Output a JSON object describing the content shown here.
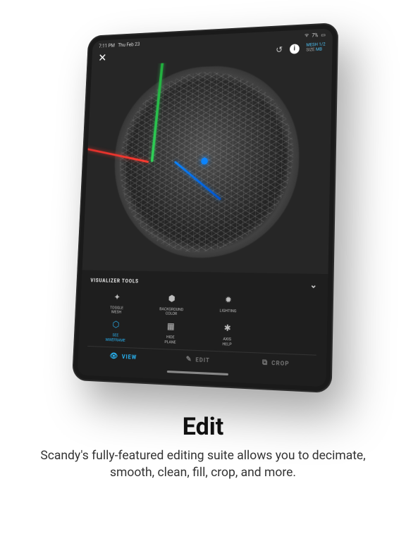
{
  "statusbar": {
    "time": "7:11 PM",
    "date": "Thu Feb 23",
    "wifi": "wifi-icon",
    "battery_pct": "7%"
  },
  "topbar": {
    "close": "✕",
    "undo": "↺",
    "info": "i",
    "mesh_label": "MESH",
    "mesh_count": "1/2",
    "size_label": "SIZE",
    "size_value": "MB"
  },
  "tools": {
    "header": "VISUALIZER TOOLS",
    "items": [
      {
        "icon": "✦",
        "label": "TOGGLE\nMESH"
      },
      {
        "icon": "⬡",
        "label": "SEE\nWIREFRAME",
        "active": true
      },
      {
        "icon": "⬢",
        "label": "BACKGROUND\nCOLOR"
      },
      {
        "icon": "▦",
        "label": "HIDE\nPLANE"
      },
      {
        "icon": "✹",
        "label": "LIGHTING"
      },
      {
        "icon": "✱",
        "label": "AXIS\nHELP"
      }
    ]
  },
  "tabs": {
    "view": {
      "icon": "👁",
      "label": "VIEW",
      "active": true
    },
    "edit": {
      "icon": "✎",
      "label": "EDIT"
    },
    "crop": {
      "icon": "⧉",
      "label": "CROP"
    }
  },
  "axis_colors": {
    "x": "#ff3b30",
    "y": "#30d158",
    "z": "#0a84ff"
  },
  "caption": {
    "title": "Edit",
    "body": "Scandy's fully-featured editing suite allows you to decimate, smooth, clean, fill, crop, and more."
  }
}
